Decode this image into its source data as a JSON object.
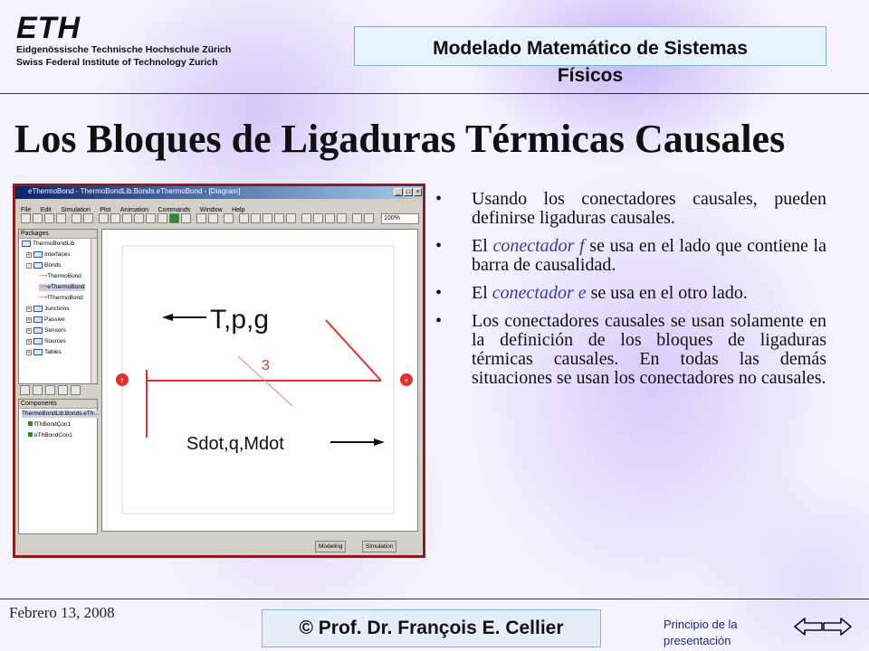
{
  "header": {
    "logo_mark": "ETH",
    "logo_line1": "Eidgenössische Technische Hochschule Zürich",
    "logo_line2": "Swiss Federal Institute of Technology Zurich",
    "course_line1": "Modelado Matemático de Sistemas",
    "course_line2": "Físicos"
  },
  "slide": {
    "title": "Los Bloques de Ligaduras Térmicas Causales"
  },
  "screenshot": {
    "window_title": "eThermoBond - ThermoBondLib.Bonds.eThermoBond - [Diagram]",
    "menu": [
      "File",
      "Edit",
      "Simulation",
      "Plot",
      "Animation",
      "Commands",
      "Window",
      "Help"
    ],
    "zoom": "100%",
    "packages_label": "Packages",
    "tree": [
      {
        "label": "ThermoBondLib",
        "level": 0,
        "selected": false
      },
      {
        "label": "Interfaces",
        "level": 1,
        "selected": false
      },
      {
        "label": "Bonds",
        "level": 1,
        "selected": false
      },
      {
        "label": "ThermoBond",
        "level": 2,
        "selected": false
      },
      {
        "label": "eThermoBond",
        "level": 2,
        "selected": true
      },
      {
        "label": "fThermoBond",
        "level": 2,
        "selected": false
      },
      {
        "label": "Junctions",
        "level": 1,
        "selected": false
      },
      {
        "label": "Passive",
        "level": 1,
        "selected": false
      },
      {
        "label": "Sensors",
        "level": 1,
        "selected": false
      },
      {
        "label": "Sources",
        "level": 1,
        "selected": false
      },
      {
        "label": "Tables",
        "level": 1,
        "selected": false
      }
    ],
    "components_label": "Components",
    "components": [
      {
        "label": "ThermoBondLib.Bonds.eTh..."
      },
      {
        "label": "fThBondCon1"
      },
      {
        "label": "eThBondCon1"
      }
    ],
    "diagram_top_label": "T,p,g",
    "diagram_number": "3",
    "diagram_bottom_label": "Sdot,q,Mdot",
    "connector_left": "f",
    "connector_right": "e",
    "tab_modeling": "Modeling",
    "tab_simulation": "Simulation"
  },
  "bullets": [
    {
      "before": "Usando los conectadores causales, pueden definirse ligaduras causales.",
      "highlight": "",
      "after": ""
    },
    {
      "before": "El ",
      "highlight": "conectador f",
      "after": " se usa en el lado que contiene la barra de causalidad."
    },
    {
      "before": "El ",
      "highlight": "conectador e",
      "after": " se usa en el otro lado."
    },
    {
      "before": "Los conectadores causales se usan solamente en la definición de los bloques de ligaduras térmicas causales.  En todas las demás situaciones se usan los conectadores no causales.",
      "highlight": "",
      "after": ""
    }
  ],
  "footer": {
    "date": "Febrero 13, 2008",
    "author": "© Prof. Dr. François E. Cellier",
    "home_link_line1": "Principio de la",
    "home_link_line2": "presentación"
  },
  "colors": {
    "accent_blue": "#3a3aa8",
    "frame_red": "#8b1d1d",
    "diagram_red": "#e03030"
  }
}
